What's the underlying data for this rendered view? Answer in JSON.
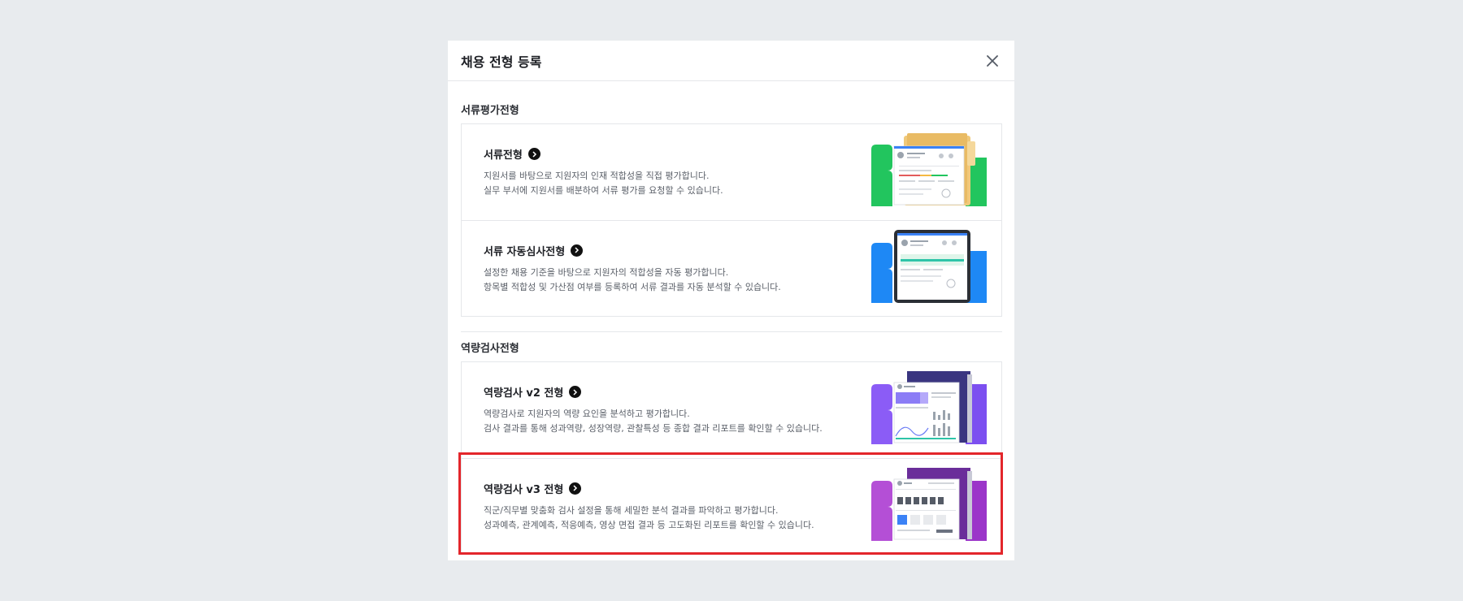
{
  "modal": {
    "title": "채용 전형 등록"
  },
  "sections": [
    {
      "title": "서류평가전형",
      "cards": [
        {
          "title": "서류전형",
          "desc1": "지원서를 바탕으로 지원자의 인재 적합성을 직접 평가합니다.",
          "desc2": "실무 부서에 지원서를 배분하여 서류 평가를 요청할 수 있습니다."
        },
        {
          "title": "서류 자동심사전형",
          "desc1": "설정한 채용 기준을 바탕으로 지원자의 적합성을 자동 평가합니다.",
          "desc2": "항목별 적합성 및 가산점 여부를 등록하여 서류 결과를 자동 분석할 수 있습니다."
        }
      ]
    },
    {
      "title": "역량검사전형",
      "cards": [
        {
          "title": "역량검사 v2 전형",
          "desc1": "역량검사로 지원자의 역량 요인을 분석하고 평가합니다.",
          "desc2": "검사 결과를 통해 성과역량, 성장역량, 관찰특성 등 종합 결과 리포트를 확인할 수 있습니다."
        },
        {
          "title": "역량검사 v3 전형",
          "desc1": "직군/직무별 맞춤화 검사 설정을 통해 세밀한 분석 결과를 파악하고 평가합니다.",
          "desc2": "성과예측, 관계예측, 적응예측, 영상 면접 결과 등 고도화된 리포트를 확인할 수 있습니다."
        }
      ]
    }
  ],
  "colors": {
    "accent_green": "#22c55e",
    "accent_blue": "#1e88f5",
    "accent_violet": "#8b5cf6",
    "accent_purple": "#a44fd6",
    "highlight": "#e3262b"
  },
  "icons": {
    "close": "close-icon",
    "arrow": "chevron-right-icon"
  }
}
